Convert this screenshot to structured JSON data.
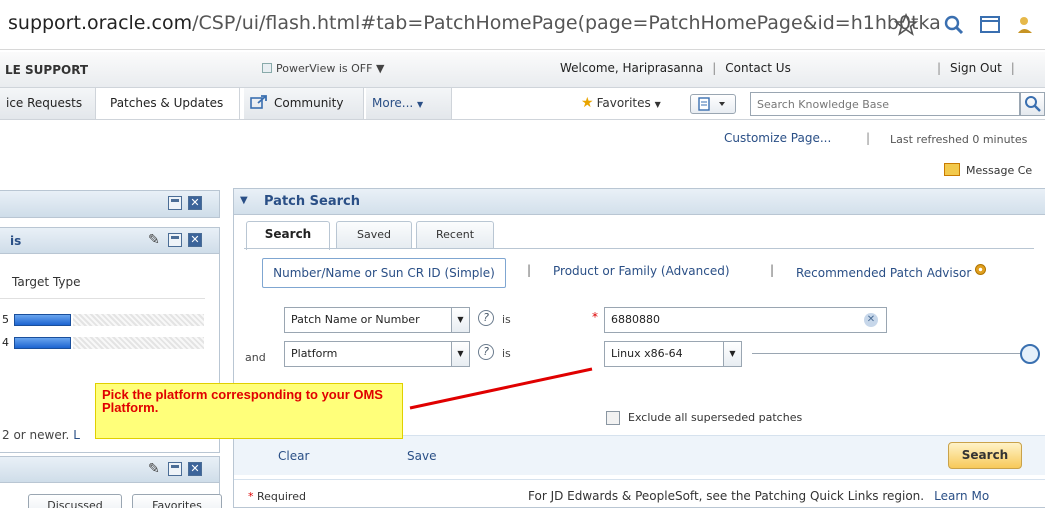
{
  "browser": {
    "url_host": "support.oracle.com",
    "url_path": "/CSP/ui/flash.html#tab=PatchHomePage(page=PatchHomePage&id=h1hb0tka"
  },
  "header": {
    "brand": "LE SUPPORT",
    "powerview": "PowerView is OFF",
    "welcome": "Welcome, Hariprasanna",
    "contact_us": "Contact Us",
    "sign_out": "Sign Out"
  },
  "nav": {
    "tabs": [
      {
        "label": "ice Requests"
      },
      {
        "label": "Patches & Updates"
      },
      {
        "label": "Community"
      },
      {
        "label": "More..."
      }
    ],
    "favorites": "Favorites",
    "search_placeholder": "Search Knowledge Base"
  },
  "toolbar": {
    "customize": "Customize Page...",
    "refreshed": "Last refreshed 0 minutes",
    "message_center": "Message Ce"
  },
  "left": {
    "panel2_title": "is",
    "target_type": "Target Type",
    "bars": [
      {
        "num": "5",
        "fraction": 0.3
      },
      {
        "num": "4",
        "fraction": 0.3
      }
    ],
    "newer_text": "2 or newer.",
    "newer_link": "L",
    "buttons": [
      "Discussed",
      "Favorites"
    ]
  },
  "patch_search": {
    "title": "Patch Search",
    "tabs": [
      "Search",
      "Saved",
      "Recent"
    ],
    "mode_simple": "Number/Name or Sun CR ID (Simple)",
    "mode_advanced": "Product or Family (Advanced)",
    "mode_recommended": "Recommended Patch Advisor",
    "row1_field": "Patch Name or Number",
    "row1_op": "is",
    "row1_value": "6880880",
    "and_label": "and",
    "row2_field": "Platform",
    "row2_op": "is",
    "row2_value": "Linux x86-64",
    "exclude_label": "Exclude all superseded patches",
    "clear": "Clear",
    "save": "Save",
    "search_button": "Search",
    "required": "Required",
    "footer_text": "For JD Edwards & PeopleSoft, see the Patching Quick Links region.",
    "learn_more": "Learn Mo"
  },
  "callout": {
    "text": "Pick the platform corresponding to your OMS Platform."
  },
  "colors": {
    "accent": "#2a4f86",
    "callout_bg": "#ffff7a",
    "callout_text": "#e00000"
  }
}
